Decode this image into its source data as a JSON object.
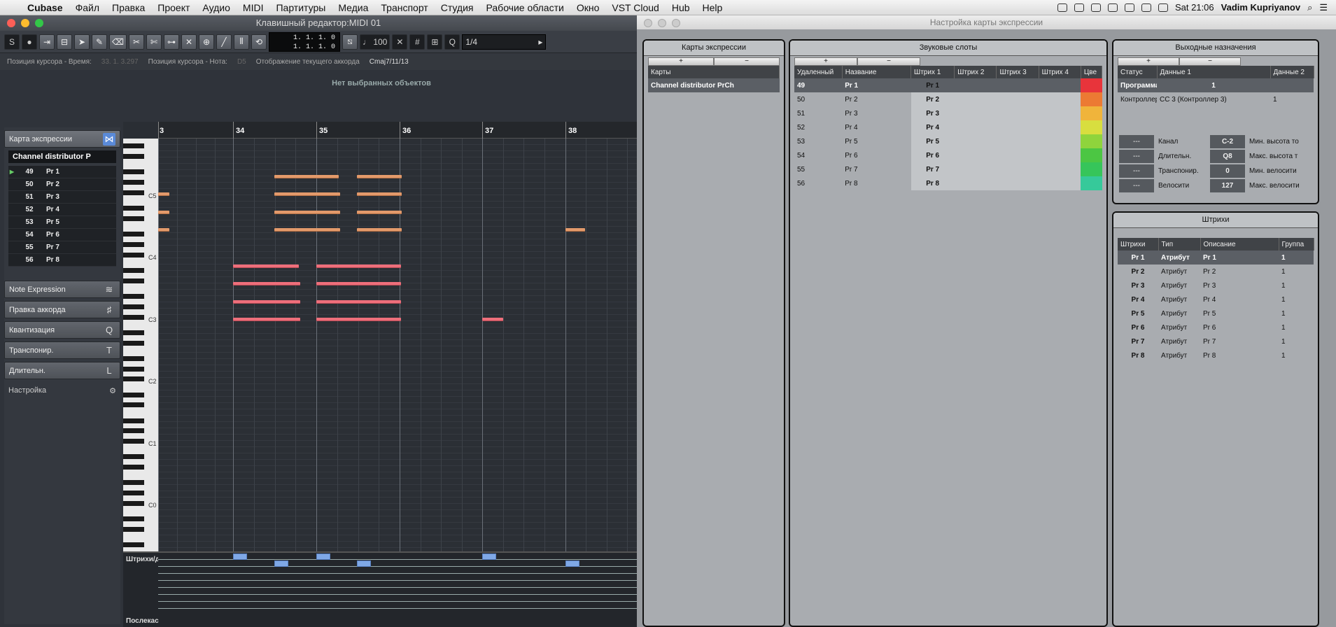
{
  "menubar": {
    "app": "Cubase",
    "items": [
      "Файл",
      "Правка",
      "Проект",
      "Аудио",
      "MIDI",
      "Партитуры",
      "Медиа",
      "Транспорт",
      "Студия",
      "Рабочие области",
      "Окно",
      "VST Cloud",
      "Hub",
      "Help"
    ],
    "clock": "Sat 21:06",
    "user": "Vadim Kupriyanov"
  },
  "key_editor": {
    "title": "Клавишный редактор:MIDI 01",
    "timecode_top": "1.  1.  1.    0",
    "timecode_bottom": "1.  1.  1.    0",
    "velocity": "100",
    "quantize": "1/4",
    "info": {
      "cursor_time_label": "Позиция курсора - Время:",
      "cursor_time_value": "33.  1.  3.297",
      "cursor_note_label": "Позиция курсора - Нота:",
      "cursor_note_value": "D5",
      "chord_label": "Отображение текущего аккорда",
      "chord_value": "Cmaj7/11/13"
    },
    "no_selection": "Нет выбранных объектов",
    "inspector": {
      "expression_map_label": "Карта экспрессии",
      "map_name": "Channel distributor P",
      "articulations": [
        {
          "num": "49",
          "name": "Pr 1"
        },
        {
          "num": "50",
          "name": "Pr 2"
        },
        {
          "num": "51",
          "name": "Pr 3"
        },
        {
          "num": "52",
          "name": "Pr 4"
        },
        {
          "num": "53",
          "name": "Pr 5"
        },
        {
          "num": "54",
          "name": "Pr 6"
        },
        {
          "num": "55",
          "name": "Pr 7"
        },
        {
          "num": "56",
          "name": "Pr 8"
        }
      ],
      "sections": [
        "Note Expression",
        "Правка аккорда",
        "Квантизация",
        "Транспонир.",
        "Длительн."
      ],
      "section_icons": [
        "≋",
        "♯",
        "Q",
        "T",
        "L"
      ],
      "setup_label": "Настройка"
    },
    "ruler_bars": [
      "3",
      "34",
      "35",
      "36",
      "37",
      "38"
    ],
    "keyboard_labels": [
      "C5",
      "C4",
      "C3",
      "C2",
      "C1",
      "C0"
    ],
    "lanes": {
      "articulation": "Штрихи/д",
      "aftertouch": "Послекас"
    }
  },
  "expression_setup": {
    "title": "Настройка карты экспрессии",
    "maps_panel": {
      "title": "Карты экспрессии",
      "plus": "+",
      "minus": "−",
      "header": "Карты",
      "items": [
        "Channel distributor PrCh"
      ]
    },
    "sound_slots": {
      "title": "Звуковые слоты",
      "plus": "+",
      "minus": "−",
      "headers": [
        "Удаленный",
        "Название",
        "Штрих 1",
        "Штрих 2",
        "Штрих 3",
        "Штрих 4",
        "Цве"
      ],
      "rows": [
        {
          "remote": "49",
          "name": "Pr 1",
          "art1": "Pr 1"
        },
        {
          "remote": "50",
          "name": "Pr 2",
          "art1": "Pr 2"
        },
        {
          "remote": "51",
          "name": "Pr 3",
          "art1": "Pr 3"
        },
        {
          "remote": "52",
          "name": "Pr 4",
          "art1": "Pr 4"
        },
        {
          "remote": "53",
          "name": "Pr 5",
          "art1": "Pr 5"
        },
        {
          "remote": "54",
          "name": "Pr 6",
          "art1": "Pr 6"
        },
        {
          "remote": "55",
          "name": "Pr 7",
          "art1": "Pr 7"
        },
        {
          "remote": "56",
          "name": "Pr 8",
          "art1": "Pr 8"
        }
      ],
      "colors": [
        "#e8343b",
        "#ec7a33",
        "#f0b43b",
        "#d8de3f",
        "#8fd43c",
        "#4cc643",
        "#36c55a",
        "#36c99a"
      ]
    },
    "output_mapping": {
      "title": "Выходные назначения",
      "plus": "+",
      "minus": "−",
      "headers": [
        "Статус",
        "Данные 1",
        "Данные 2"
      ],
      "rows": [
        {
          "status": "Программа",
          "d1": "1",
          "d2": ""
        },
        {
          "status": "Контроллер",
          "d1": "CC 3  (Контроллер 3)",
          "d2": "1"
        }
      ],
      "params": [
        {
          "dash": "---",
          "label": "Канал",
          "value": "C-2",
          "label2": "Мин. высота то"
        },
        {
          "dash": "---",
          "label": "Длительн.",
          "value": "Q8",
          "label2": "Макс. высота т"
        },
        {
          "dash": "---",
          "label": "Транспонир.",
          "value": "0",
          "label2": "Мин. велосити"
        },
        {
          "dash": "---",
          "label": "Велосити",
          "value": "127",
          "label2": "Макс. велосити"
        }
      ]
    },
    "articulations": {
      "title": "Штрихи",
      "headers": [
        "Штрихи",
        "Тип",
        "Описание",
        "Группа"
      ],
      "rows": [
        {
          "art": "Pr 1",
          "type": "Атрибут",
          "desc": "Pr 1",
          "group": "1"
        },
        {
          "art": "Pr 2",
          "type": "Атрибут",
          "desc": "Pr 2",
          "group": "1"
        },
        {
          "art": "Pr 3",
          "type": "Атрибут",
          "desc": "Pr 3",
          "group": "1"
        },
        {
          "art": "Pr 4",
          "type": "Атрибут",
          "desc": "Pr 4",
          "group": "1"
        },
        {
          "art": "Pr 5",
          "type": "Атрибут",
          "desc": "Pr 5",
          "group": "1"
        },
        {
          "art": "Pr 6",
          "type": "Атрибут",
          "desc": "Pr 6",
          "group": "1"
        },
        {
          "art": "Pr 7",
          "type": "Атрибут",
          "desc": "Pr 7",
          "group": "1"
        },
        {
          "art": "Pr 8",
          "type": "Атрибут",
          "desc": "Pr 8",
          "group": "1"
        }
      ]
    }
  }
}
